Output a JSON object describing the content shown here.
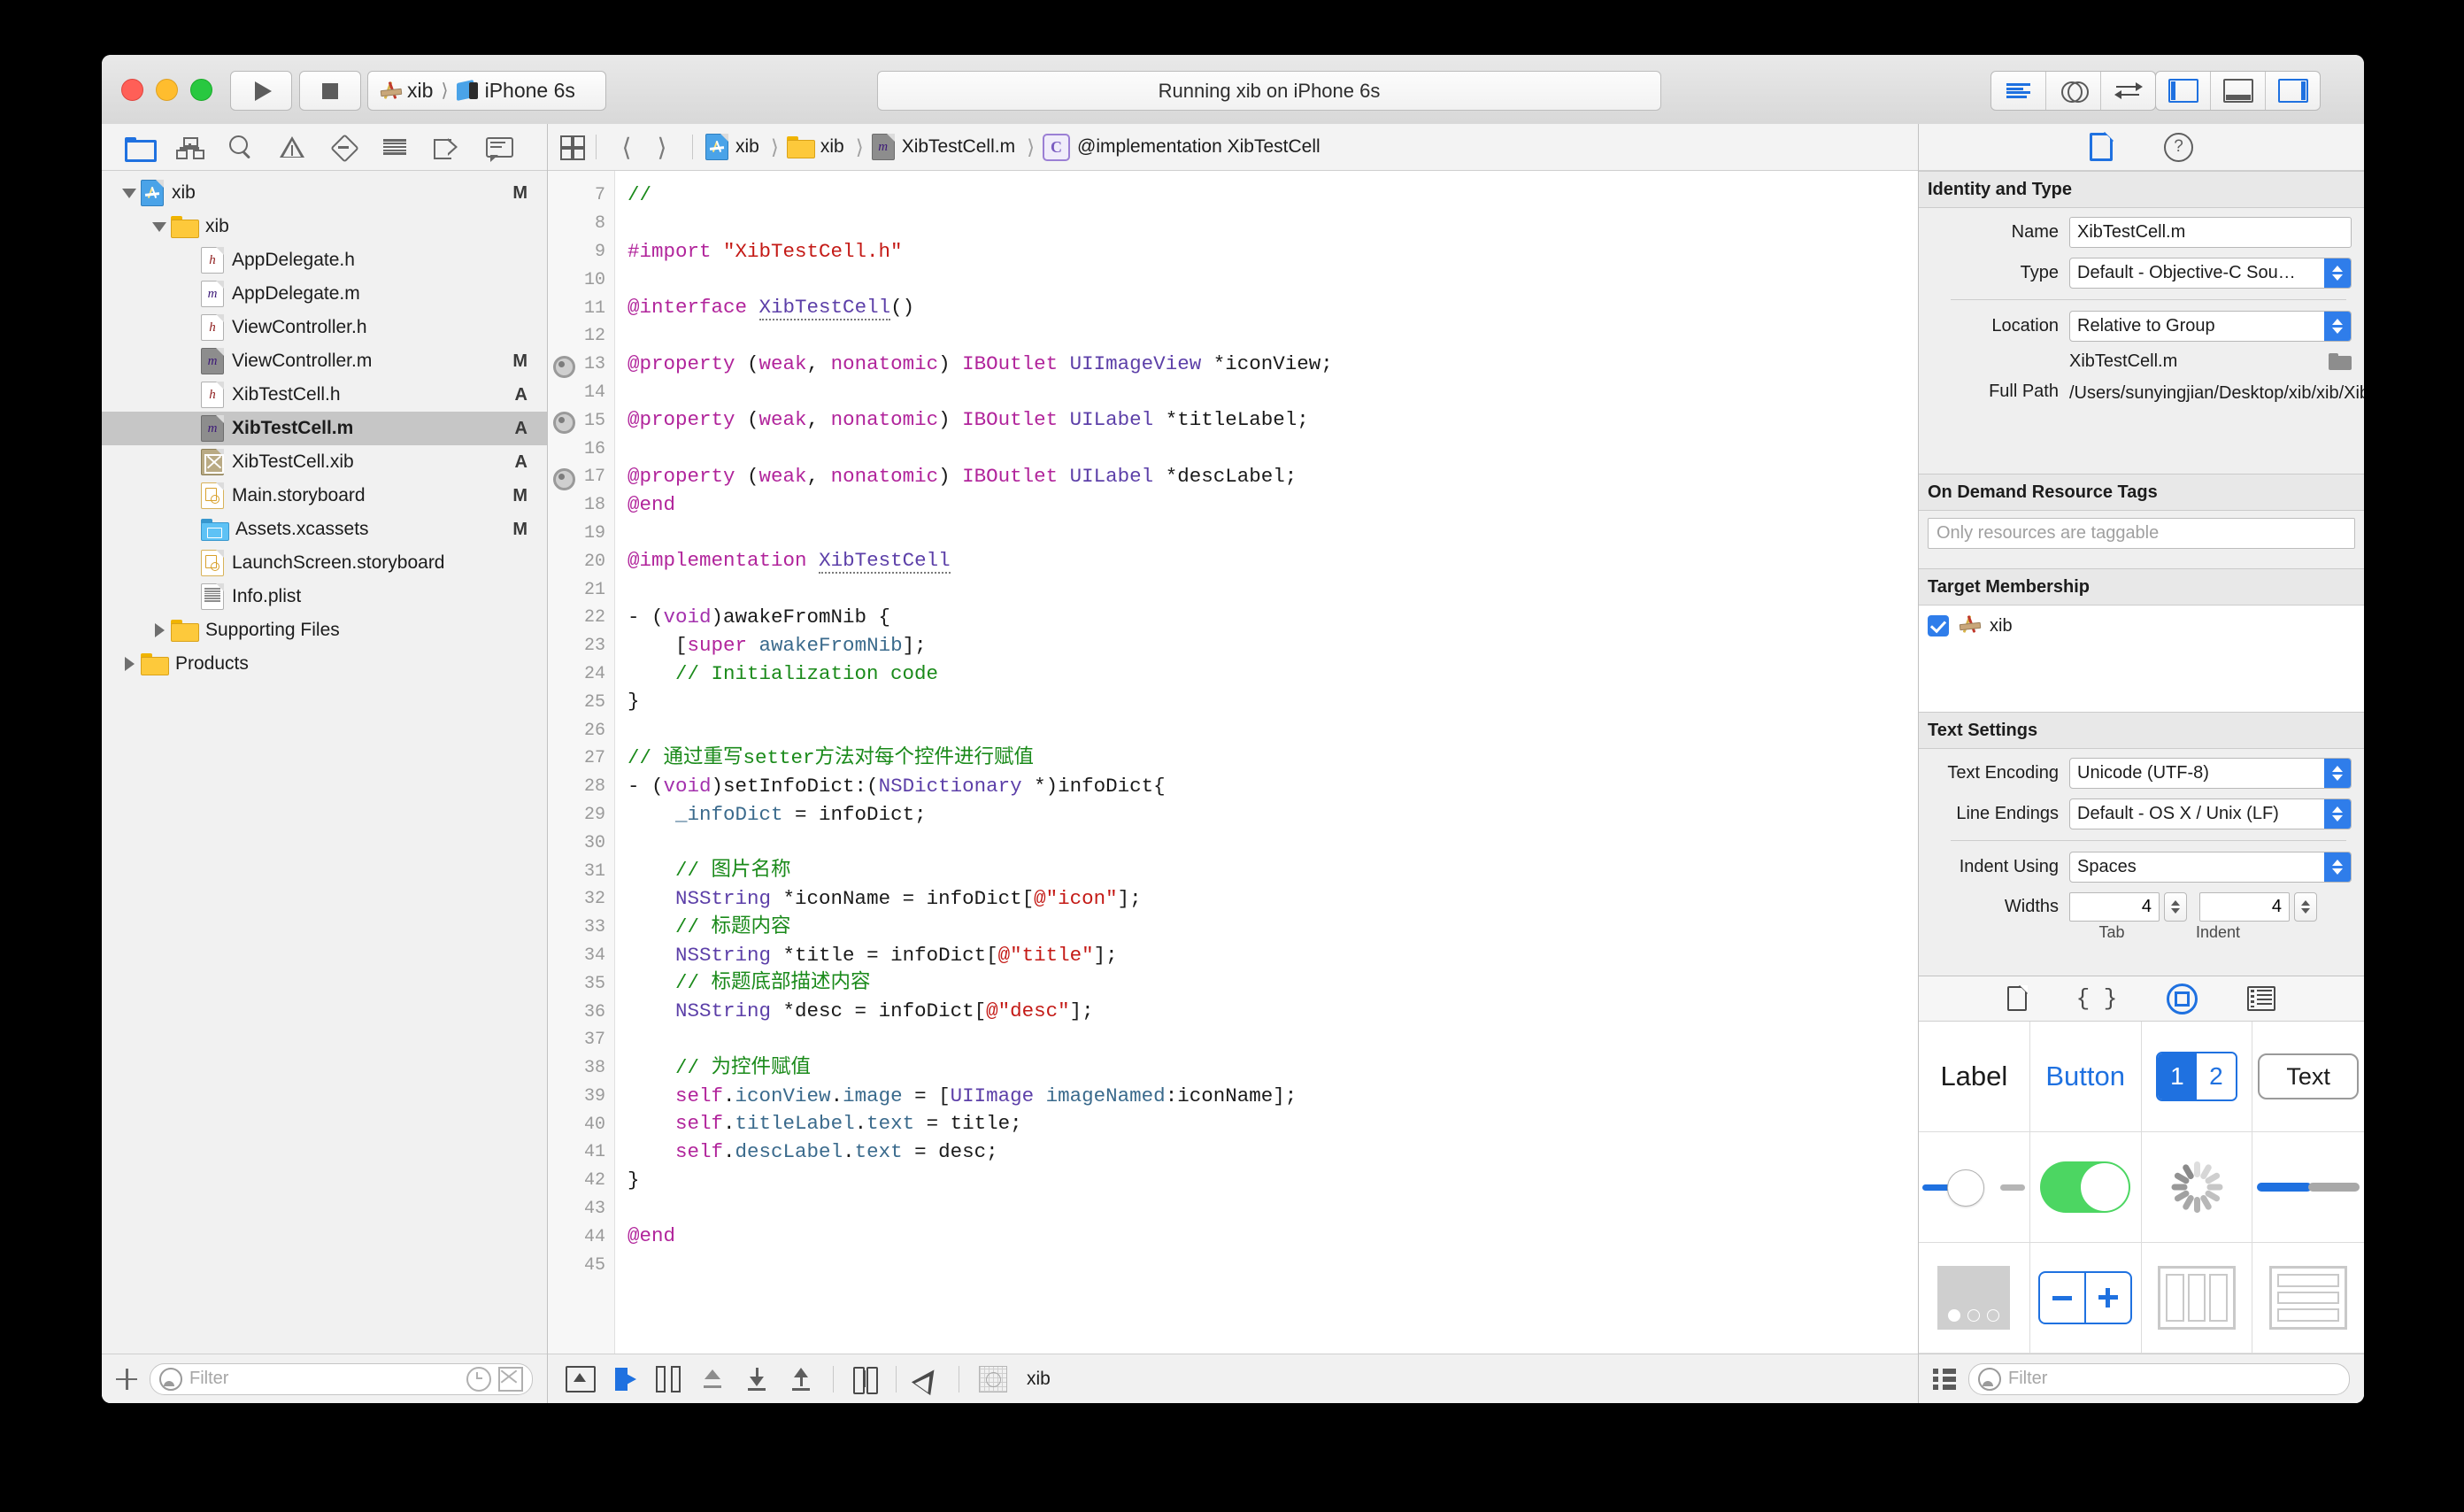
{
  "window": {
    "title_status": "Running xib on iPhone 6s",
    "scheme": "xib",
    "destination": "iPhone 6s"
  },
  "navigator": {
    "toolbar_icons": [
      "folder-icon",
      "hierarchy-icon",
      "search-icon",
      "warning-icon",
      "issue-icon",
      "test-icon",
      "tag-icon",
      "comment-icon"
    ],
    "tree": [
      {
        "label": "xib",
        "status": "M",
        "icon": "project-icon",
        "depth": 0,
        "twist": "down",
        "selected": false
      },
      {
        "label": "xib",
        "status": "",
        "icon": "folder-icon",
        "depth": 1,
        "twist": "down",
        "selected": false
      },
      {
        "label": "AppDelegate.h",
        "status": "",
        "icon": "header-file-icon",
        "depth": 2,
        "twist": "none",
        "selected": false
      },
      {
        "label": "AppDelegate.m",
        "status": "",
        "icon": "source-file-icon",
        "depth": 2,
        "twist": "none",
        "selected": false
      },
      {
        "label": "ViewController.h",
        "status": "",
        "icon": "header-file-icon",
        "depth": 2,
        "twist": "none",
        "selected": false
      },
      {
        "label": "ViewController.m",
        "status": "M",
        "icon": "source-file-gray-icon",
        "depth": 2,
        "twist": "none",
        "selected": false
      },
      {
        "label": "XibTestCell.h",
        "status": "A",
        "icon": "header-file-icon",
        "depth": 2,
        "twist": "none",
        "selected": false
      },
      {
        "label": "XibTestCell.m",
        "status": "A",
        "icon": "source-file-gray-icon",
        "depth": 2,
        "twist": "none",
        "selected": true
      },
      {
        "label": "XibTestCell.xib",
        "status": "A",
        "icon": "xib-file-icon",
        "depth": 2,
        "twist": "none",
        "selected": false
      },
      {
        "label": "Main.storyboard",
        "status": "M",
        "icon": "storyboard-icon",
        "depth": 2,
        "twist": "none",
        "selected": false
      },
      {
        "label": "Assets.xcassets",
        "status": "M",
        "icon": "assets-icon",
        "depth": 2,
        "twist": "none",
        "selected": false
      },
      {
        "label": "LaunchScreen.storyboard",
        "status": "",
        "icon": "storyboard-icon",
        "depth": 2,
        "twist": "none",
        "selected": false
      },
      {
        "label": "Info.plist",
        "status": "",
        "icon": "plist-icon",
        "depth": 2,
        "twist": "none",
        "selected": false
      },
      {
        "label": "Supporting Files",
        "status": "",
        "icon": "folder-icon",
        "depth": 1,
        "twist": "right",
        "selected": false
      },
      {
        "label": "Products",
        "status": "",
        "icon": "folder-icon",
        "depth": 0,
        "twist": "right",
        "selected": false
      }
    ],
    "filter_placeholder": "Filter"
  },
  "editor": {
    "breadcrumb": [
      {
        "label": "xib",
        "icon": "project-icon"
      },
      {
        "label": "xib",
        "icon": "folder-icon"
      },
      {
        "label": "XibTestCell.m",
        "icon": "source-file-gray-icon"
      },
      {
        "label": "@implementation XibTestCell",
        "icon": "class-icon"
      }
    ],
    "first_line_number": 7,
    "breakpoint_lines": [
      13,
      15,
      17
    ],
    "lines": [
      {
        "n": 7,
        "html": "<span class=\"c\">//</span>"
      },
      {
        "n": 8,
        "html": ""
      },
      {
        "n": 9,
        "html": "<span class=\"k\">#import</span> <span class=\"s\">\"XibTestCell.h\"</span>"
      },
      {
        "n": 10,
        "html": ""
      },
      {
        "n": 11,
        "html": "<span class=\"k\">@interface</span> <span class=\"t u\">XibTestCell</span>()"
      },
      {
        "n": 12,
        "html": ""
      },
      {
        "n": 13,
        "html": "<span class=\"k\">@property</span> (<span class=\"k\">weak</span>, <span class=\"k\">nonatomic</span>) <span class=\"k\">IBOutlet</span> <span class=\"t\">UIImageView</span> *iconView;"
      },
      {
        "n": 14,
        "html": ""
      },
      {
        "n": 15,
        "html": "<span class=\"k\">@property</span> (<span class=\"k\">weak</span>, <span class=\"k\">nonatomic</span>) <span class=\"k\">IBOutlet</span> <span class=\"t\">UILabel</span> *titleLabel;"
      },
      {
        "n": 16,
        "html": ""
      },
      {
        "n": 17,
        "html": "<span class=\"k\">@property</span> (<span class=\"k\">weak</span>, <span class=\"k\">nonatomic</span>) <span class=\"k\">IBOutlet</span> <span class=\"t\">UILabel</span> *descLabel;"
      },
      {
        "n": 18,
        "html": "<span class=\"k\">@end</span>"
      },
      {
        "n": 19,
        "html": ""
      },
      {
        "n": 20,
        "html": "<span class=\"k\">@implementation</span> <span class=\"t u\">XibTestCell</span>"
      },
      {
        "n": 21,
        "html": ""
      },
      {
        "n": 22,
        "html": "- (<span class=\"kw\">void</span>)awakeFromNib {"
      },
      {
        "n": 23,
        "html": "    [<span class=\"k\">super</span> <span class=\"p\">awakeFromNib</span>];"
      },
      {
        "n": 24,
        "html": "    <span class=\"c\">// Initialization code</span>"
      },
      {
        "n": 25,
        "html": "}"
      },
      {
        "n": 26,
        "html": ""
      },
      {
        "n": 27,
        "html": "<span class=\"c\">// 通过重写setter方法对每个控件进行赋值</span>"
      },
      {
        "n": 28,
        "html": "- (<span class=\"kw\">void</span>)setInfoDict:(<span class=\"t\">NSDictionary</span> *)infoDict{"
      },
      {
        "n": 29,
        "html": "    <span class=\"p\">_infoDict</span> = infoDict;"
      },
      {
        "n": 30,
        "html": ""
      },
      {
        "n": 31,
        "html": "    <span class=\"c\">// 图片名称</span>"
      },
      {
        "n": 32,
        "html": "    <span class=\"t\">NSString</span> *iconName = infoDict[<span class=\"s\">@\"icon\"</span>];"
      },
      {
        "n": 33,
        "html": "    <span class=\"c\">// 标题内容</span>"
      },
      {
        "n": 34,
        "html": "    <span class=\"t\">NSString</span> *title = infoDict[<span class=\"s\">@\"title\"</span>];"
      },
      {
        "n": 35,
        "html": "    <span class=\"c\">// 标题底部描述内容</span>"
      },
      {
        "n": 36,
        "html": "    <span class=\"t\">NSString</span> *desc = infoDict[<span class=\"s\">@\"desc\"</span>];"
      },
      {
        "n": 37,
        "html": ""
      },
      {
        "n": 38,
        "html": "    <span class=\"c\">// 为控件赋值</span>"
      },
      {
        "n": 39,
        "html": "    <span class=\"self\">self</span>.<span class=\"p\">iconView</span>.<span class=\"p\">image</span> = [<span class=\"t\">UIImage</span> <span class=\"p\">imageNamed</span>:iconName];"
      },
      {
        "n": 40,
        "html": "    <span class=\"self\">self</span>.<span class=\"p\">titleLabel</span>.<span class=\"p\">text</span> = title;"
      },
      {
        "n": 41,
        "html": "    <span class=\"self\">self</span>.<span class=\"p\">descLabel</span>.<span class=\"p\">text</span> = desc;"
      },
      {
        "n": 42,
        "html": "}"
      },
      {
        "n": 43,
        "html": ""
      },
      {
        "n": 44,
        "html": "<span class=\"k\">@end</span>"
      },
      {
        "n": 45,
        "html": ""
      }
    ],
    "debug_bar_label": "xib"
  },
  "inspector": {
    "tabs": [
      "file-inspector-icon",
      "quick-help-icon"
    ],
    "identity": {
      "title": "Identity and Type",
      "name_label": "Name",
      "name_value": "XibTestCell.m",
      "type_label": "Type",
      "type_value": "Default - Objective-C Sou…",
      "location_label": "Location",
      "location_value": "Relative to Group",
      "location_file": "XibTestCell.m",
      "fullpath_label": "Full Path",
      "fullpath_value": "/Users/sunyingjian/Desktop/xib/xib/XibTestCell.m"
    },
    "odrt": {
      "title": "On Demand Resource Tags",
      "placeholder": "Only resources are taggable"
    },
    "target_membership": {
      "title": "Target Membership",
      "items": [
        {
          "label": "xib",
          "checked": true
        }
      ]
    },
    "text_settings": {
      "title": "Text Settings",
      "encoding_label": "Text Encoding",
      "encoding_value": "Unicode (UTF-8)",
      "line_endings_label": "Line Endings",
      "line_endings_value": "Default - OS X / Unix (LF)",
      "indent_label": "Indent Using",
      "indent_value": "Spaces",
      "widths_label": "Widths",
      "tab_width": "4",
      "indent_width": "4",
      "tab_sublabel": "Tab",
      "indent_sublabel": "Indent"
    }
  },
  "library": {
    "tabs": [
      "file-template-library-icon",
      "code-snippet-library-icon",
      "object-library-icon",
      "media-library-icon"
    ],
    "active_tab": 2,
    "items": [
      {
        "name": "label-object",
        "text": "Label"
      },
      {
        "name": "button-object",
        "text": "Button"
      },
      {
        "name": "segmented-control-object",
        "text": "1 2"
      },
      {
        "name": "text-field-object",
        "text": "Text"
      },
      {
        "name": "slider-object",
        "text": ""
      },
      {
        "name": "switch-object",
        "text": ""
      },
      {
        "name": "activity-indicator-object",
        "text": ""
      },
      {
        "name": "progress-view-object",
        "text": ""
      },
      {
        "name": "page-control-object",
        "text": ""
      },
      {
        "name": "stepper-object",
        "text": ""
      },
      {
        "name": "horizontal-stack-view-object",
        "text": ""
      },
      {
        "name": "vertical-stack-view-object",
        "text": ""
      }
    ],
    "filter_placeholder": "Filter"
  },
  "colors": {
    "accent": "#1f71e0",
    "selection": "#c6c6c6",
    "comment": "#1a8a1a",
    "string": "#c41a16",
    "keyword": "#b1249b",
    "type": "#5c3fa8"
  }
}
